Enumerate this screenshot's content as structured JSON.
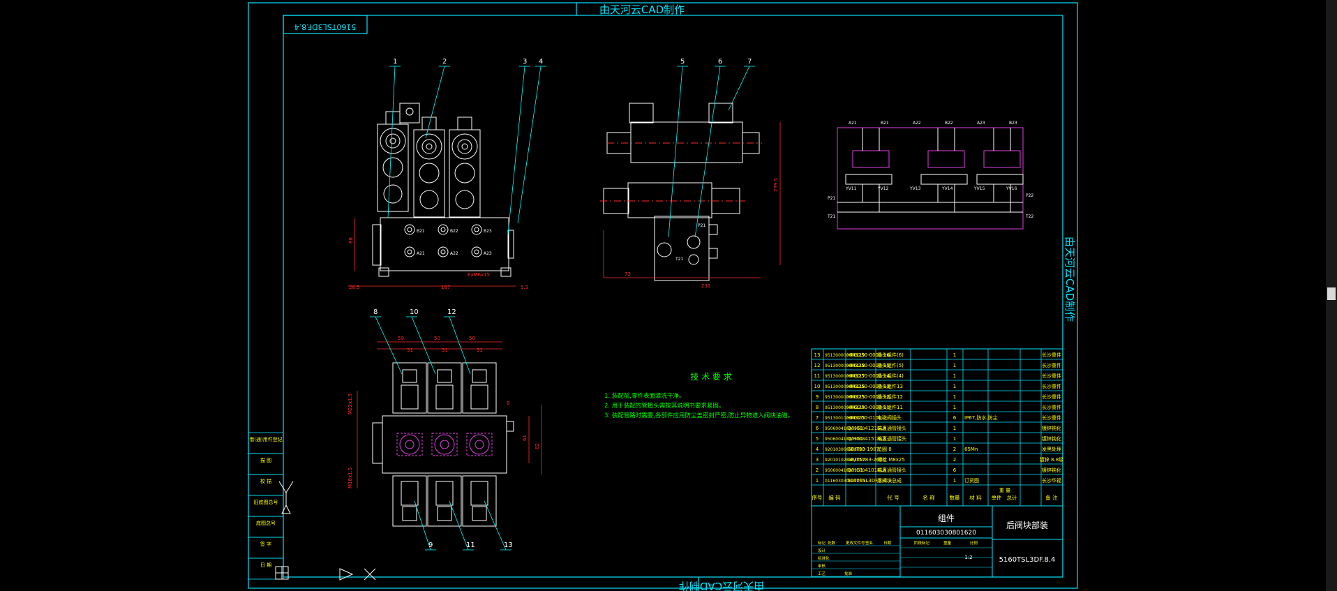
{
  "watermark": "由天河云CAD制作",
  "stamp_code": "5160TSL3DF.8.4",
  "callouts": [
    "1",
    "2",
    "3",
    "4",
    "5",
    "6",
    "7",
    "8",
    "10",
    "12",
    "9",
    "11",
    "13"
  ],
  "dims": {
    "front_height": "88",
    "front_left": "28.5",
    "front_width": "187",
    "front_right": "5.3",
    "side_total": "231",
    "side_left": "73",
    "side_height": "239.5",
    "thread_note": "6xM6x15",
    "top_pitch_a": "59",
    "top_pitch_b": "50",
    "top_pitch_c": "50",
    "top_sub_a": "31",
    "top_sub_b": "31",
    "top_sub_c": "31",
    "plan_h1": "82",
    "plan_h2": "61",
    "plan_l1": "M22x1.5",
    "plan_l2": "M18x1.5",
    "plan_r1": "8"
  },
  "port_labels": [
    "B21",
    "B22",
    "B23",
    "A21",
    "A22",
    "A23",
    "P21",
    "T21"
  ],
  "schematic": {
    "top_labels": [
      "A21",
      "B21",
      "A22",
      "B22",
      "A23",
      "B23"
    ],
    "bottom_labels": [
      "YV11",
      "YV12",
      "YV13",
      "YV14",
      "YV15",
      "YV16"
    ],
    "left_labels": [
      "P21",
      "T21"
    ],
    "right_labels": [
      "P22",
      "T22"
    ]
  },
  "tech": {
    "title": "技 术 要 求",
    "items": [
      "1. 装配前,零件表面清洗干净。",
      "2. 用于装配的管接头需按其说明书要求紧固。",
      "3. 装配管路时需要,各部件应用防尘盖密封严密,防止异物进入阀块油道。"
    ]
  },
  "bom": {
    "rows": [
      {
        "no": "13",
        "code": "951300000000119",
        "model": "HM3250-0000-16",
        "name": "插头组件(6)",
        "qty": "1",
        "mat": "",
        "note": "长沙重件"
      },
      {
        "no": "12",
        "code": "951300000000118",
        "model": "HM3250-0000-15",
        "name": "插头组件(5)",
        "qty": "1",
        "mat": "",
        "note": "长沙重件"
      },
      {
        "no": "11",
        "code": "951300000000117",
        "model": "HM3250-0000-14",
        "name": "插头组件(4)",
        "qty": "1",
        "mat": "",
        "note": "长沙重件"
      },
      {
        "no": "10",
        "code": "951300000000116",
        "model": "HM3250-0000-13",
        "name": "插头组件13",
        "qty": "1",
        "mat": "",
        "note": "长沙重件"
      },
      {
        "no": "9",
        "code": "951300000000115",
        "model": "HM3250-0000-12",
        "name": "插头组件12",
        "qty": "1",
        "mat": "",
        "note": "长沙重件"
      },
      {
        "no": "8",
        "code": "951300000000114",
        "model": "HM3250-0000-11",
        "name": "插头组件11",
        "qty": "1",
        "mat": "",
        "note": "长沙重件"
      },
      {
        "no": "7",
        "code": "951300100000003",
        "model": "HM3250-0100",
        "name": "电磁阀插头",
        "qty": "6",
        "mat": "IP67,防水,防尘",
        "note": "长沙重件"
      },
      {
        "no": "6",
        "code": "950600410005010",
        "model": "Q/HG1.41216LX",
        "name": "端直通管接头",
        "qty": "1",
        "mat": "",
        "note": "镀锌钝化"
      },
      {
        "no": "5",
        "code": "950600410005018",
        "model": "Q/HG1.41518LX",
        "name": "端直通管接头",
        "qty": "1",
        "mat": "",
        "note": "镀锌钝化"
      },
      {
        "no": "4",
        "code": "920103060008010",
        "model": "GB/T93-1987",
        "name": "垫圈 8",
        "qty": "2",
        "mat": "65Mn",
        "note": "发黑处理"
      },
      {
        "no": "3",
        "code": "920101020204010",
        "model": "GB/T5783-2000",
        "name": "螺栓 M8x25",
        "qty": "2",
        "mat": "",
        "note": "镀锌 8.8级"
      },
      {
        "no": "2",
        "code": "950600410001100",
        "model": "Q/HG1.41014LX",
        "name": "端直通管接头",
        "qty": "6",
        "mat": "",
        "note": "镀锌钝化"
      },
      {
        "no": "1",
        "code": "011603030817050",
        "model": "5160TSL3DF.8.4.1",
        "name": "后阀块总成",
        "qty": "1",
        "mat": "订货图",
        "note": "长沙华福"
      }
    ],
    "header": [
      "序号",
      "编 码",
      "代 号",
      "名 称",
      "数量",
      "材 料",
      "单件",
      "总计",
      "备 注"
    ],
    "mass_header": "重 量"
  },
  "title_block": {
    "group": "组件",
    "code": "011603030801620",
    "name": "后阀块部装",
    "drawing_no": "5160TSL3DF.8.4",
    "scale": "1:2",
    "labels": [
      "标记",
      "处数",
      "更改文件号",
      "签名",
      "日期",
      "设计",
      "标准化",
      "审核",
      "工艺",
      "批准",
      "阶段标记",
      "重量",
      "比例"
    ]
  },
  "side_panel": [
    "借(通)用件登记",
    "描 图",
    "校 描",
    "旧底图总号",
    "底图总号",
    "签 字",
    "日 期"
  ],
  "colors": {
    "frame": "#00e5ff",
    "geometry": "#ffffff",
    "leader": "#00ffff",
    "dimension": "#ff2a2a",
    "hidden": "#e040e0",
    "bom_text": "#ffff00",
    "tech_text": "#00ff00",
    "callout": "#ffffff"
  }
}
